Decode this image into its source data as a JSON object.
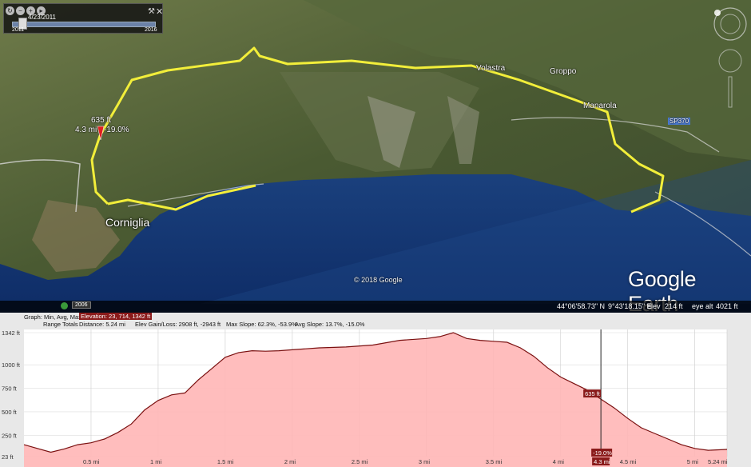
{
  "time_slider": {
    "date": "4/23/2011",
    "start_year": "2011",
    "end_year": "2016"
  },
  "map": {
    "towns": [
      "Corniglia",
      "Volastra",
      "Manarola",
      "Groppo"
    ],
    "road_label": "SP370",
    "marker": {
      "elev": "635 ft",
      "dist": "4.3 mi",
      "slope": "-19.0%"
    },
    "copyright": "© 2018 Google",
    "logo": "Google Earth",
    "imagery_year": "2006",
    "icons": [
      "zoom-icon",
      "play-icon",
      "wrench-icon",
      "close-icon",
      "compass-icon",
      "look-icon",
      "zoom-slider-icon",
      "ruler-icon"
    ]
  },
  "status_bar": {
    "lat": "44°06'58.73\" N",
    "lon": "9°43'18.15\" E",
    "elev_label": "elev",
    "elev_value": "214 ft",
    "eye_label": "eye alt",
    "eye_value": "4021 ft"
  },
  "profile": {
    "graph_label": "Graph: Min, Avg, Max",
    "range_label": "Range Totals",
    "elevation": "Elevation: 23, 714, 1342 ft",
    "distance": "Distance: 5.24 mi",
    "gain_loss": "Elev Gain/Loss: 2908 ft, -2943 ft",
    "max_slope": "Max Slope: 62.3%, -53.9%",
    "avg_slope": "Avg Slope: 13.7%, -15.0%",
    "cursor_elev": "635 ft",
    "cursor_slope": "-19.0%",
    "cursor_dist": "4.3 mi"
  },
  "chart_data": {
    "type": "area",
    "ylabel_ticks": [
      "1342 ft",
      "1000 ft",
      "750 ft",
      "500 ft",
      "250 ft",
      "23 ft"
    ],
    "y_tick_values": [
      1342,
      1000,
      750,
      500,
      250,
      23
    ],
    "x_ticks": [
      "0.5 mi",
      "1 mi",
      "1.5 mi",
      "2 mi",
      "2.5 mi",
      "3 mi",
      "3.5 mi",
      "4 mi",
      "4.5 mi",
      "5 mi",
      "5.24 mi"
    ],
    "x_tick_values": [
      0.5,
      1,
      1.5,
      2,
      2.5,
      3,
      3.5,
      4,
      4.5,
      5,
      5.24
    ],
    "xlim": [
      0,
      5.24
    ],
    "ylim": [
      23,
      1342
    ],
    "fill_color": "#ffb6b6",
    "line_color": "#7a1010",
    "cursor_x": 4.3,
    "series": [
      {
        "x": [
          0,
          0.1,
          0.2,
          0.3,
          0.4,
          0.5,
          0.6,
          0.7,
          0.8,
          0.9,
          1.0,
          1.1,
          1.2,
          1.3,
          1.4,
          1.5,
          1.6,
          1.7,
          1.8,
          1.9,
          2.0,
          2.2,
          2.4,
          2.6,
          2.8,
          3.0,
          3.1,
          3.2,
          3.3,
          3.4,
          3.5,
          3.6,
          3.7,
          3.8,
          3.9,
          4.0,
          4.1,
          4.2,
          4.3,
          4.4,
          4.5,
          4.6,
          4.7,
          4.8,
          4.9,
          5.0,
          5.1,
          5.24
        ],
        "y": [
          150,
          110,
          70,
          105,
          150,
          170,
          210,
          280,
          370,
          520,
          620,
          680,
          700,
          840,
          960,
          1080,
          1130,
          1150,
          1145,
          1150,
          1160,
          1180,
          1190,
          1210,
          1260,
          1280,
          1300,
          1342,
          1280,
          1260,
          1250,
          1240,
          1180,
          1090,
          970,
          870,
          800,
          730,
          635,
          540,
          430,
          330,
          270,
          210,
          150,
          110,
          90,
          100
        ]
      }
    ]
  }
}
